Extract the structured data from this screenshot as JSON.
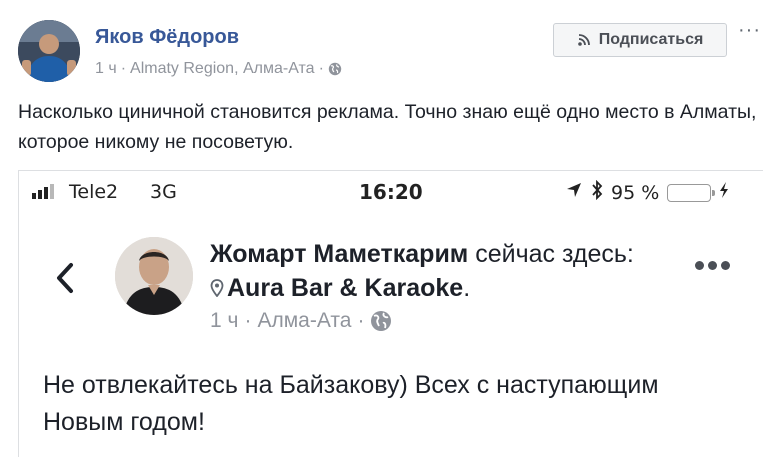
{
  "post": {
    "author": "Яков Фёдоров",
    "time": "1 ч",
    "location": "Almaty Region, Алма-Ата",
    "separator": "·",
    "subscribe_label": "Подписаться",
    "more": "···",
    "text": "Насколько циничной становится реклама. Точно знаю ещё одно место в Алматы, которое никому не посоветую."
  },
  "screenshot": {
    "status": {
      "carrier": "Tele2",
      "network": "3G",
      "clock": "16:20",
      "battery": "95 %",
      "battery_level": 0.95
    },
    "author": "Жомарт Маметкарим",
    "action": " сейчас здесь: ",
    "place": "Aura Bar & Karaoke",
    "place_suffix": ".",
    "time": "1 ч",
    "separator": "·",
    "location": "Алма-Ата",
    "text": "Не отвлекайтесь на Байзакову) Всех с наступающим Новым годом!"
  },
  "colors": {
    "link_blue": "#385898",
    "meta_gray": "#90949c",
    "battery_green": "#4cd964"
  },
  "icons": [
    "rss-icon",
    "globe-icon",
    "signal-icon",
    "location-arrow-icon",
    "bluetooth-icon",
    "battery-icon",
    "charging-icon",
    "back-chevron-icon",
    "map-pin-icon",
    "more-dots-icon"
  ]
}
